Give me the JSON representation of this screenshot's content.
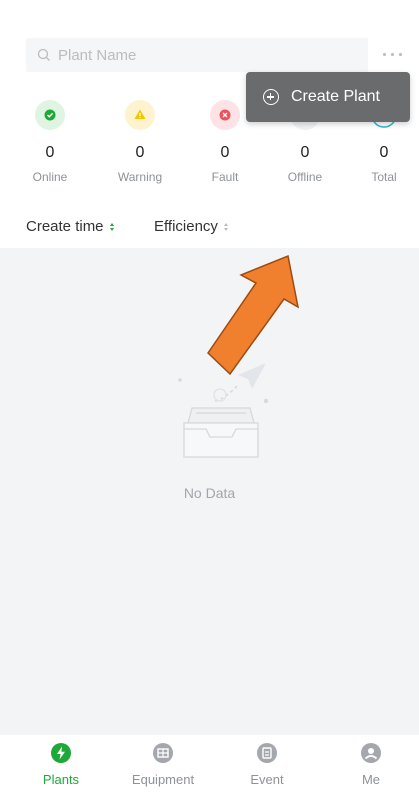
{
  "search": {
    "placeholder": "Plant Name"
  },
  "stats": [
    {
      "label": "Online",
      "value": "0",
      "color": "#1ea838",
      "icon": "check-icon"
    },
    {
      "label": "Warning",
      "value": "0",
      "color": "#f7c400",
      "icon": "warning-icon"
    },
    {
      "label": "Fault",
      "value": "0",
      "color": "#f0505a",
      "icon": "fault-icon"
    },
    {
      "label": "Offline",
      "value": "0",
      "color": "#c9ccd0",
      "icon": "offline-icon"
    },
    {
      "label": "Total",
      "value": "0",
      "color": "#2bb3c8",
      "icon": "total-icon"
    }
  ],
  "sort": {
    "create_time": "Create time",
    "efficiency": "Efficiency"
  },
  "menu": {
    "create_plant": "Create Plant"
  },
  "empty": {
    "text": "No Data"
  },
  "tabs": [
    {
      "label": "Plants",
      "icon": "bolt-icon",
      "active": true
    },
    {
      "label": "Equipment",
      "icon": "equipment-icon",
      "active": false
    },
    {
      "label": "Event",
      "icon": "event-icon",
      "active": false
    },
    {
      "label": "Me",
      "icon": "user-icon",
      "active": false
    }
  ],
  "colors": {
    "accent": "#1ea838",
    "annotation_arrow": "#f07f2e"
  }
}
